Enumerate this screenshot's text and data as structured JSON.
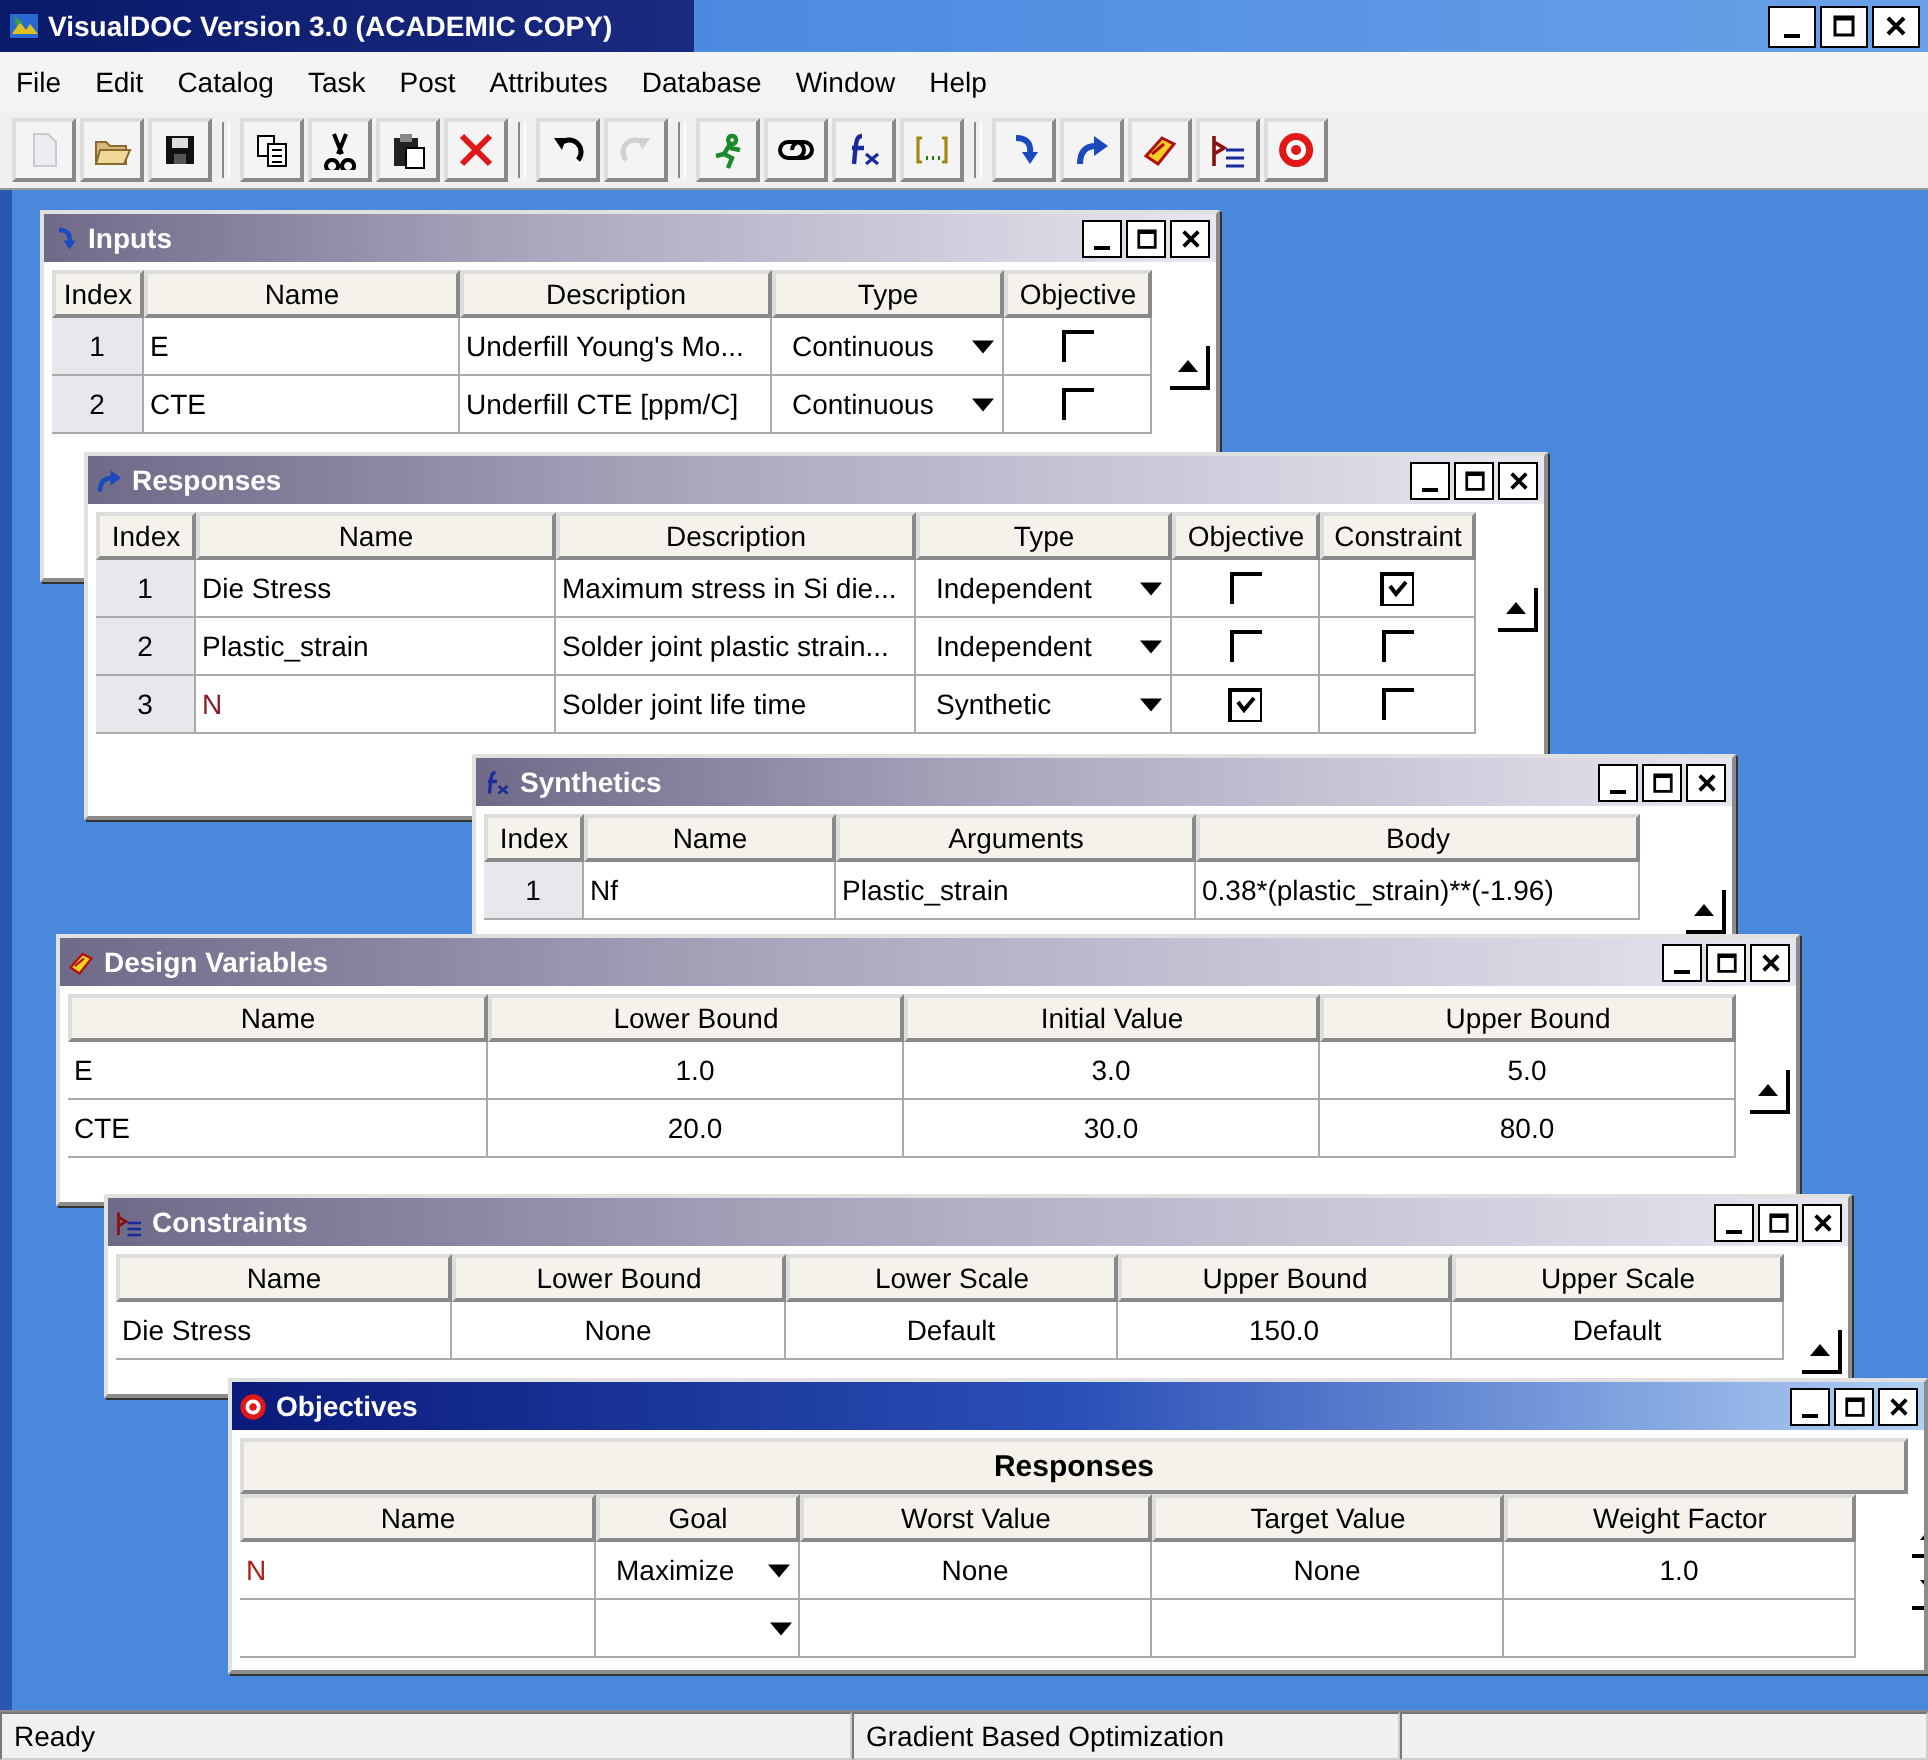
{
  "app": {
    "title": "VisualDOC Version 3.0 (ACADEMIC COPY)"
  },
  "menu": [
    "File",
    "Edit",
    "Catalog",
    "Task",
    "Post",
    "Attributes",
    "Database",
    "Window",
    "Help"
  ],
  "toolbar": [
    {
      "disabled": true
    },
    {
      "disabled": false
    },
    {
      "disabled": false
    },
    {
      "disabled": false
    },
    {
      "disabled": false
    },
    {
      "disabled": false
    },
    {
      "disabled": false
    },
    {
      "disabled": false
    },
    {
      "disabled": true
    },
    {
      "disabled": false
    },
    {
      "disabled": false
    },
    {
      "disabled": false
    },
    {
      "disabled": false
    },
    {
      "disabled": false
    },
    {
      "disabled": false
    },
    {
      "disabled": false
    },
    {
      "disabled": false
    },
    {
      "disabled": false
    }
  ],
  "windows": [
    {
      "title": "Inputs",
      "active": false,
      "columns": [
        {
          "label": "Index",
          "kind": "index"
        },
        {
          "label": "Name",
          "kind": "name"
        },
        {
          "label": "Description",
          "kind": "name"
        },
        {
          "label": "Type",
          "kind": "dropdown"
        },
        {
          "label": "Objective",
          "kind": "checkbox"
        }
      ],
      "rows": [
        {
          "cells": [
            "1",
            "E",
            "Underfill Young's Mo...",
            "Continuous",
            {
              "checked": false
            }
          ]
        },
        {
          "cells": [
            "2",
            "CTE",
            "Underfill CTE [ppm/C]",
            "Continuous",
            {
              "checked": false
            }
          ]
        }
      ]
    },
    {
      "title": "Responses",
      "active": false,
      "columns": [
        {
          "label": "Index",
          "kind": "index"
        },
        {
          "label": "Name",
          "kind": "name"
        },
        {
          "label": "Description",
          "kind": "name"
        },
        {
          "label": "Type",
          "kind": "dropdown"
        },
        {
          "label": "Objective",
          "kind": "checkbox"
        },
        {
          "label": "Constraint",
          "kind": "checkbox"
        }
      ],
      "rows": [
        {
          "cells": [
            "1",
            "Die Stress",
            "Maximum stress in Si die...",
            "Independent",
            {
              "checked": false
            },
            {
              "checked": true
            }
          ]
        },
        {
          "cells": [
            "2",
            "Plastic_strain",
            "Solder joint plastic strain...",
            "Independent",
            {
              "checked": false
            },
            {
              "checked": false
            }
          ]
        },
        {
          "cells": [
            "3",
            {
              "text": "N",
              "color": "#8b1a2a"
            },
            "Solder joint life time",
            "Synthetic",
            {
              "checked": true
            },
            {
              "checked": false
            }
          ]
        }
      ]
    },
    {
      "title": "Synthetics",
      "active": false,
      "columns": [
        {
          "label": "Index",
          "kind": "index"
        },
        {
          "label": "Name",
          "kind": "name"
        },
        {
          "label": "Arguments",
          "kind": "name"
        },
        {
          "label": "Body",
          "kind": "name"
        }
      ],
      "rows": [
        {
          "cells": [
            "1",
            "Nf",
            "Plastic_strain",
            "0.38*(plastic_strain)**(-1.96)"
          ]
        }
      ]
    },
    {
      "title": "Design Variables",
      "active": false,
      "columns": [
        {
          "label": "Name",
          "kind": "name"
        },
        {
          "label": "Lower Bound",
          "kind": "value"
        },
        {
          "label": "Initial Value",
          "kind": "value"
        },
        {
          "label": "Upper Bound",
          "kind": "value"
        }
      ],
      "rows": [
        {
          "cells": [
            "E",
            "1.0",
            "3.0",
            "5.0"
          ]
        },
        {
          "cells": [
            "CTE",
            "20.0",
            "30.0",
            "80.0"
          ]
        }
      ]
    },
    {
      "title": "Constraints",
      "active": false,
      "columns": [
        {
          "label": "Name",
          "kind": "name"
        },
        {
          "label": "Lower Bound",
          "kind": "value"
        },
        {
          "label": "Lower Scale",
          "kind": "value"
        },
        {
          "label": "Upper Bound",
          "kind": "value"
        },
        {
          "label": "Upper Scale",
          "kind": "value"
        }
      ],
      "rows": [
        {
          "cells": [
            "Die Stress",
            "None",
            "Default",
            "150.0",
            "Default"
          ]
        }
      ]
    },
    {
      "title": "Objectives",
      "active": true,
      "group_header": "Responses",
      "columns": [
        {
          "label": "Name",
          "kind": "name"
        },
        {
          "label": "Goal",
          "kind": "dropdown"
        },
        {
          "label": "Worst Value",
          "kind": "value"
        },
        {
          "label": "Target Value",
          "kind": "value"
        },
        {
          "label": "Weight Factor",
          "kind": "value"
        }
      ],
      "rows": [
        {
          "cells": [
            {
              "text": "N",
              "color": "#b01c1c"
            },
            "Maximize",
            "None",
            "None",
            "1.0"
          ]
        },
        {
          "kind": "new"
        }
      ]
    }
  ],
  "status_bar": [
    "Ready",
    "Gradient Based Optimization"
  ]
}
